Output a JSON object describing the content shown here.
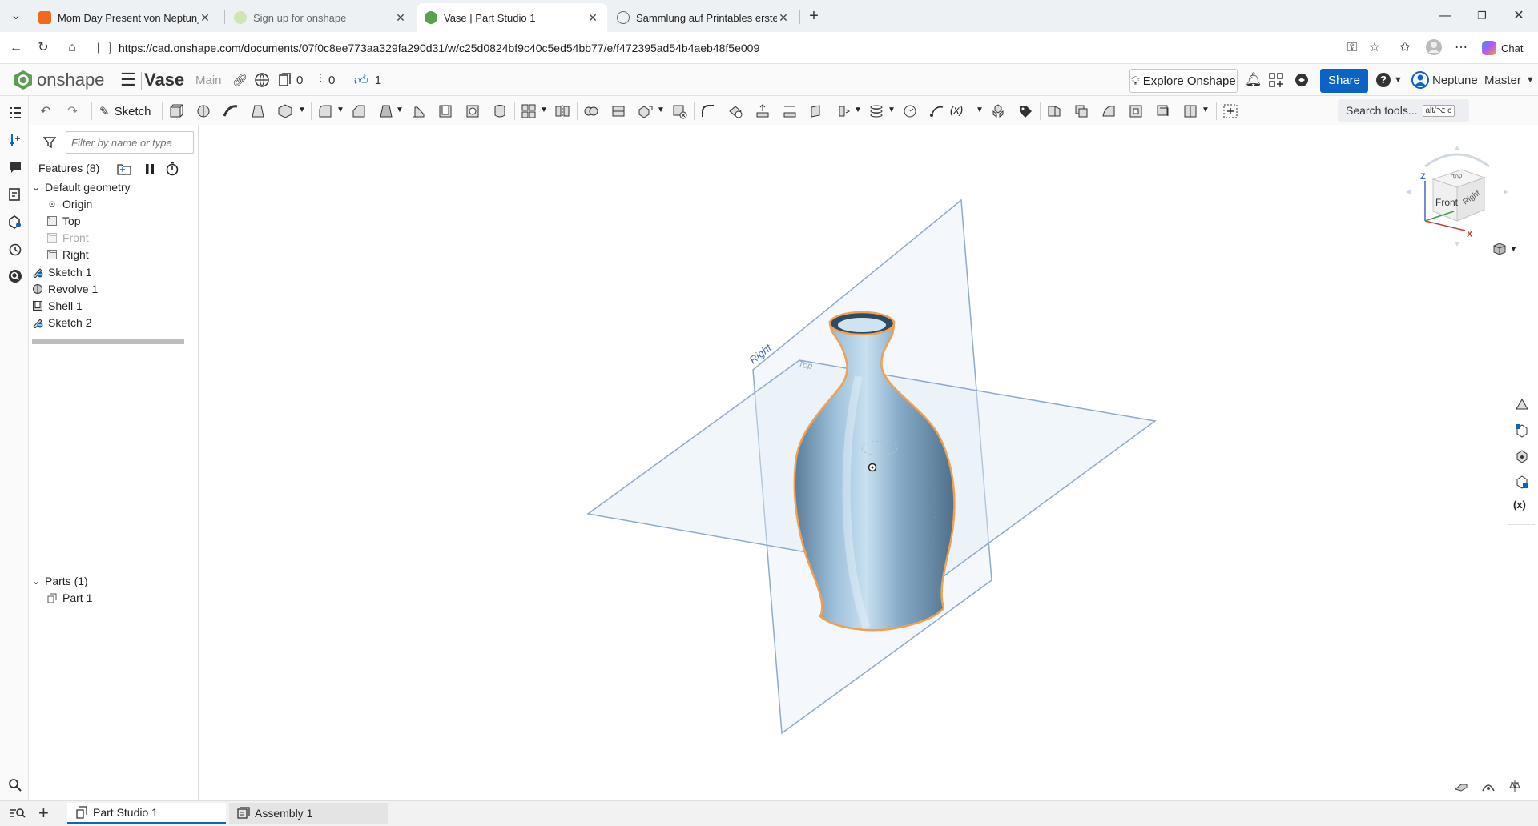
{
  "browser": {
    "tabs": [
      {
        "label": "Mom Day Present von Neptun_Ma",
        "favicon": "printables-icon",
        "color": "#f26722",
        "active": false
      },
      {
        "label": "Sign up for onshape",
        "favicon": "onshape-icon",
        "color": "#8bc34a",
        "active": false
      },
      {
        "label": "Vase | Part Studio 1",
        "favicon": "onshape-icon",
        "color": "#59a14f",
        "active": true
      },
      {
        "label": "Sammlung auf Printables erstellen",
        "favicon": "globe-icon",
        "color": "#666666",
        "active": false
      }
    ],
    "url": "https://cad.onshape.com/documents/07f0c8ee773aa329fa290d31/w/c25d0824bf9c40c5ed54bb77/e/f472395ad54b4aeb48f5e009",
    "chat_label": "Chat"
  },
  "appbar": {
    "brand": "onshape",
    "document_name": "Vase",
    "branch": "Main",
    "versions_count": "0",
    "branches_count": "0",
    "likes_count": "1",
    "explore_label": "Explore Onshape",
    "share_label": "Share",
    "user_name": "Neptune_Master",
    "accent": "#0b63c4"
  },
  "toolbar": {
    "sketch_label": "Sketch",
    "search_label": "Search tools...",
    "search_shortcut": "alt/⌥ c"
  },
  "features": {
    "filter_placeholder": "Filter by name or type",
    "header": "Features (8)",
    "default_geometry": "Default geometry",
    "planes": [
      {
        "label": "Origin",
        "icon": "origin-icon",
        "dim": false
      },
      {
        "label": "Top",
        "icon": "plane-icon",
        "dim": false
      },
      {
        "label": "Front",
        "icon": "plane-icon",
        "dim": true
      },
      {
        "label": "Right",
        "icon": "plane-icon",
        "dim": false
      }
    ],
    "items": [
      {
        "label": "Sketch 1",
        "icon": "sketch-icon"
      },
      {
        "label": "Revolve 1",
        "icon": "revolve-icon"
      },
      {
        "label": "Shell 1",
        "icon": "shell-icon"
      },
      {
        "label": "Sketch 2",
        "icon": "sketch-icon"
      }
    ],
    "parts_header": "Parts (1)",
    "parts": [
      {
        "label": "Part 1",
        "icon": "part-icon"
      }
    ]
  },
  "viewport": {
    "plane_labels": {
      "right": "Right",
      "top": "Top"
    },
    "view_cube": {
      "front": "Front",
      "right": "Right",
      "top": "Top",
      "axis_z": "Z",
      "axis_x": "X"
    },
    "vase_color": "#7fa7c6",
    "edge_color": "#f0a050"
  },
  "bottom_tabs": [
    {
      "label": "Part Studio 1",
      "icon": "part-studio-icon",
      "active": true
    },
    {
      "label": "Assembly 1",
      "icon": "assembly-icon",
      "active": false
    }
  ]
}
